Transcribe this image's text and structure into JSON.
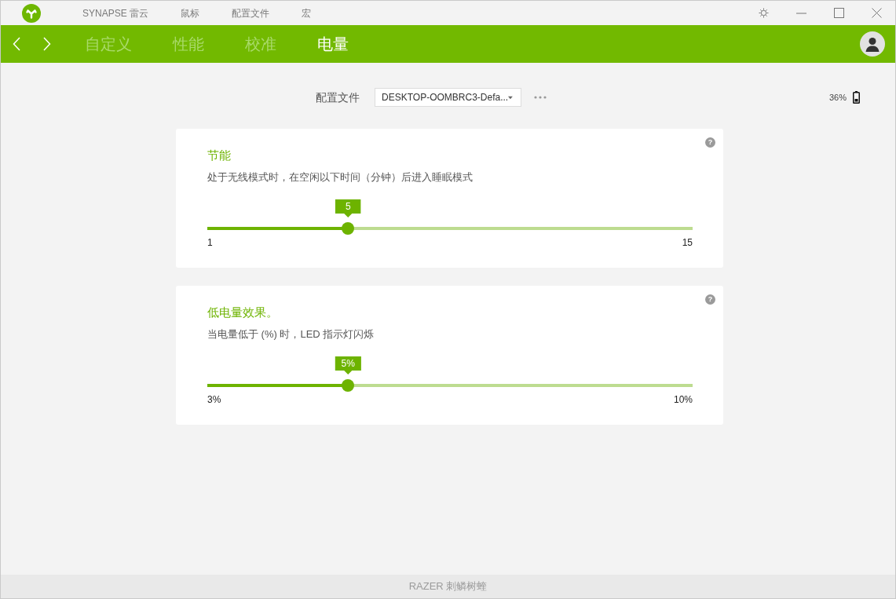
{
  "title_bar": {
    "nav": [
      {
        "label": "SYNAPSE 雷云"
      },
      {
        "label": "鼠标"
      },
      {
        "label": "配置文件"
      },
      {
        "label": "宏"
      }
    ]
  },
  "tabs": [
    {
      "label": "自定义",
      "selected": false
    },
    {
      "label": "性能",
      "selected": false
    },
    {
      "label": "校准",
      "selected": false
    },
    {
      "label": "电量",
      "selected": true
    }
  ],
  "profile": {
    "label": "配置文件",
    "value": "DESKTOP-OOMBRC3-Defa..."
  },
  "battery": {
    "reading": "36%"
  },
  "cards": [
    {
      "title": "节能",
      "help": "?",
      "description": "处于无线模式时，在空闲以下时间（分钟）后进入睡眠模式",
      "slider": {
        "value": "5",
        "min": "1",
        "max": "15",
        "level": 0.29
      }
    },
    {
      "title": "低电量效果。",
      "help": "?",
      "description": "当电量低于 (%) 时，LED 指示灯闪烁",
      "slider": {
        "value": "5%",
        "min": "3%",
        "max": "10%",
        "level": 0.29
      }
    }
  ],
  "footer": {
    "text": "RAZER 刺鳞树蝰"
  }
}
